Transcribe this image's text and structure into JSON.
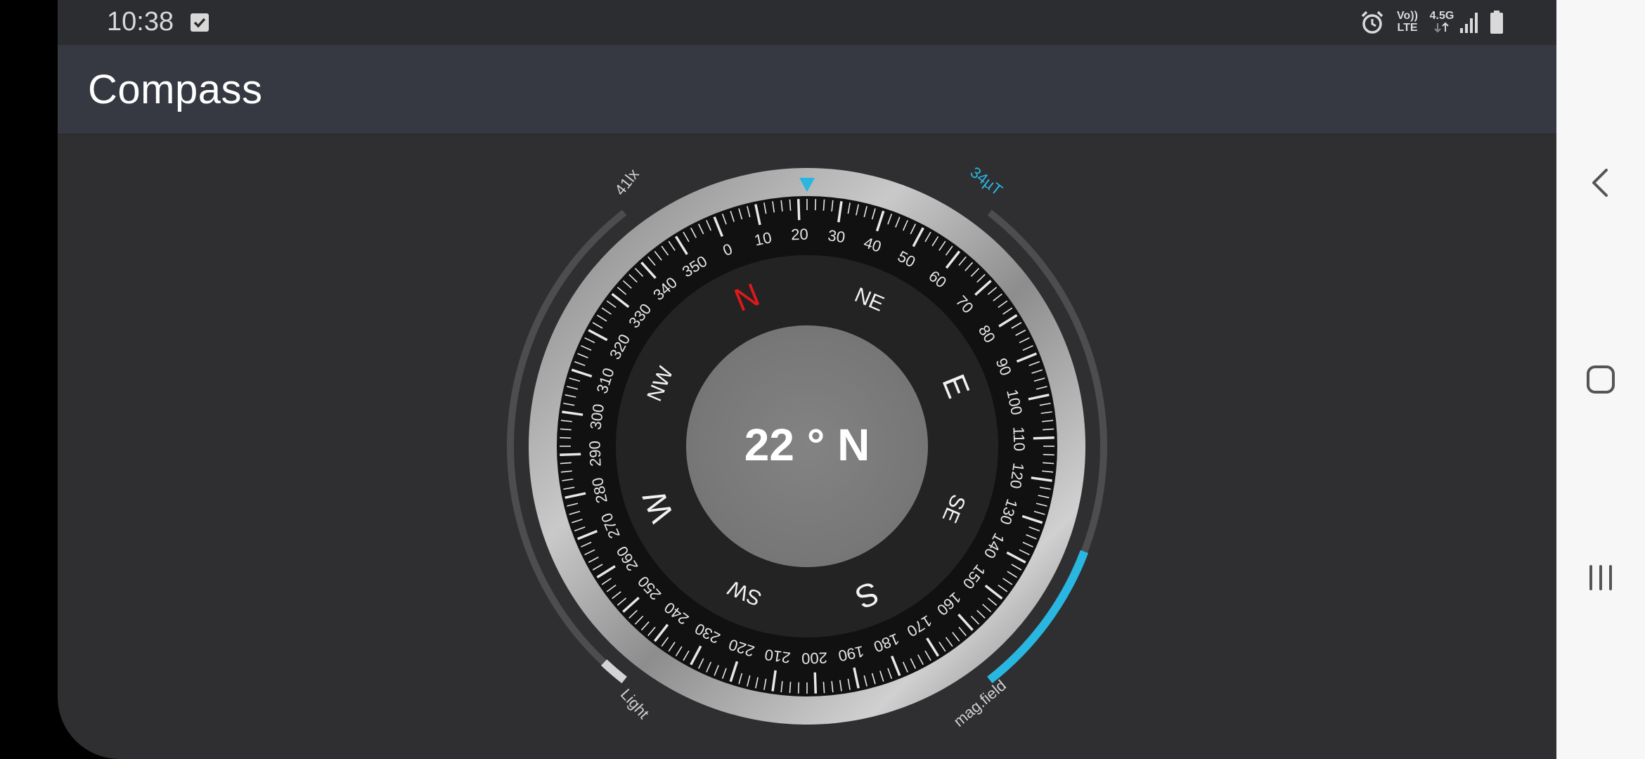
{
  "status_bar": {
    "time": "10:38",
    "icons": [
      "checkbox-icon",
      "alarm-icon",
      "volte-icon",
      "data-arrows-icon",
      "signal-icon",
      "battery-icon"
    ],
    "volte_top": "Vo))",
    "volte_bottom": "LTE",
    "network": "4.5G"
  },
  "app_bar": {
    "title": "Compass"
  },
  "compass": {
    "heading_text": "22 ° N",
    "heading_degrees": 22,
    "degree_labels": [
      "0",
      "10",
      "20",
      "30",
      "40",
      "50",
      "60",
      "70",
      "80",
      "90",
      "100",
      "110",
      "120",
      "130",
      "140",
      "150",
      "160",
      "170",
      "180",
      "190",
      "200",
      "210",
      "220",
      "230",
      "240",
      "250",
      "260",
      "270",
      "280",
      "290",
      "300",
      "310",
      "320",
      "330",
      "340",
      "350"
    ],
    "cardinals": {
      "N": "N",
      "NE": "NE",
      "E": "E",
      "SE": "SE",
      "S": "S",
      "SW": "SW",
      "W": "W",
      "NW": "NW"
    },
    "light_value": "41lx",
    "light_label": "Light",
    "light_level": 0.05,
    "mag_value": "34µT",
    "mag_label": "mag.field",
    "mag_level": 0.3,
    "colors": {
      "accent": "#29b6e0",
      "north": "#e0181c",
      "background": "#2f2f31"
    }
  },
  "nav_bar": {
    "back": "back-icon",
    "home": "home-icon",
    "recents": "recents-icon"
  }
}
